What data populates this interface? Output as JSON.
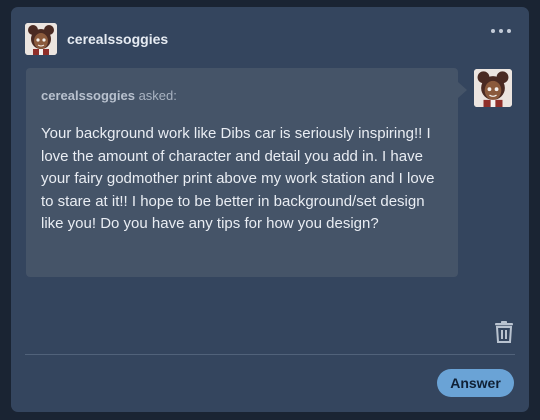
{
  "post": {
    "username": "cerealssoggies",
    "more_icon": "more-horizontal-icon"
  },
  "ask": {
    "asker_name": "cerealssoggies",
    "asked_label": "asked:",
    "question": "Your background work like Dibs car is seriously inspiring!! I love the amount of character and detail you add in. I have your fairy godmother print above my work station and I love to stare at it!! I hope to be better in background/set design like you! Do you have any tips for how you design?"
  },
  "actions": {
    "trash_icon": "trash-icon",
    "answer_label": "Answer"
  },
  "colors": {
    "background": "#1a2433",
    "card": "#34455e",
    "bubble": "#455468",
    "accent": "#6aa3d6"
  }
}
